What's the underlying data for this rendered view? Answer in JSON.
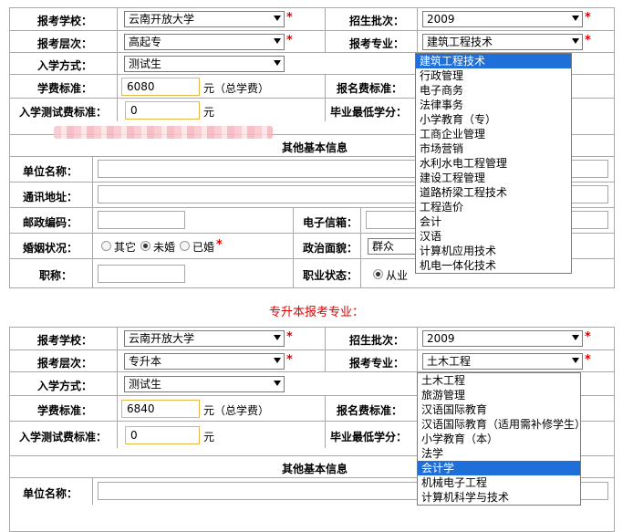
{
  "common": {
    "school_label": "报考学校：",
    "level_label": "报考层次：",
    "entry_label": "入学方式：",
    "fee_label": "学费标准：",
    "test_fee_label": "入学测试费标准：",
    "batch_label": "招生批次：",
    "major_label": "报考专业：",
    "reg_fee_label": "报名费标准：",
    "min_credit_label": "毕业最低学分：",
    "fee_unit": "元（总学费）",
    "test_fee_unit": "元",
    "other_info": "其他基本信息",
    "required_mark": "*"
  },
  "form1": {
    "school_value": "云南开放大学",
    "level_value": "高起专",
    "entry_value": "测试生",
    "fee_value": "6080",
    "test_fee_value": "0",
    "batch_value": "2009",
    "major_value": "建筑工程技术",
    "major_options": [
      "建筑工程技术",
      "行政管理",
      "电子商务",
      "法律事务",
      "小学教育（专）",
      "工商企业管理",
      "市场营销",
      "水利水电工程管理",
      "建设工程管理",
      "道路桥梁工程技术",
      "工程造价",
      "会计",
      "汉语",
      "计算机应用技术",
      "机电一体化技术"
    ],
    "selected_index": 0,
    "unit_label": "单位名称：",
    "address_label": "通讯地址：",
    "postcode_label": "邮政编码：",
    "email_label": "电子信箱：",
    "marital_label": "婚姻状况：",
    "marital_options": [
      "其它",
      "未婚",
      "已婚"
    ],
    "marital_selected": 1,
    "political_label": "政治面貌：",
    "political_value": "群众",
    "title_label": "职称：",
    "job_status_label": "职业状态：",
    "job_status_value": "从业"
  },
  "caption": "专升本报考专业：",
  "form2": {
    "school_value": "云南开放大学",
    "level_value": "专升本",
    "entry_value": "测试生",
    "fee_value": "6840",
    "test_fee_value": "0",
    "batch_value": "2009",
    "major_value": "土木工程",
    "major_options": [
      "土木工程",
      "旅游管理",
      "汉语国际教育",
      "汉语国际教育（适用需补修学生）",
      "小学教育（本）",
      "法学",
      "会计学",
      "机械电子工程",
      "计算机科学与技术"
    ],
    "selected_index": 6,
    "unit_label": "单位名称："
  }
}
